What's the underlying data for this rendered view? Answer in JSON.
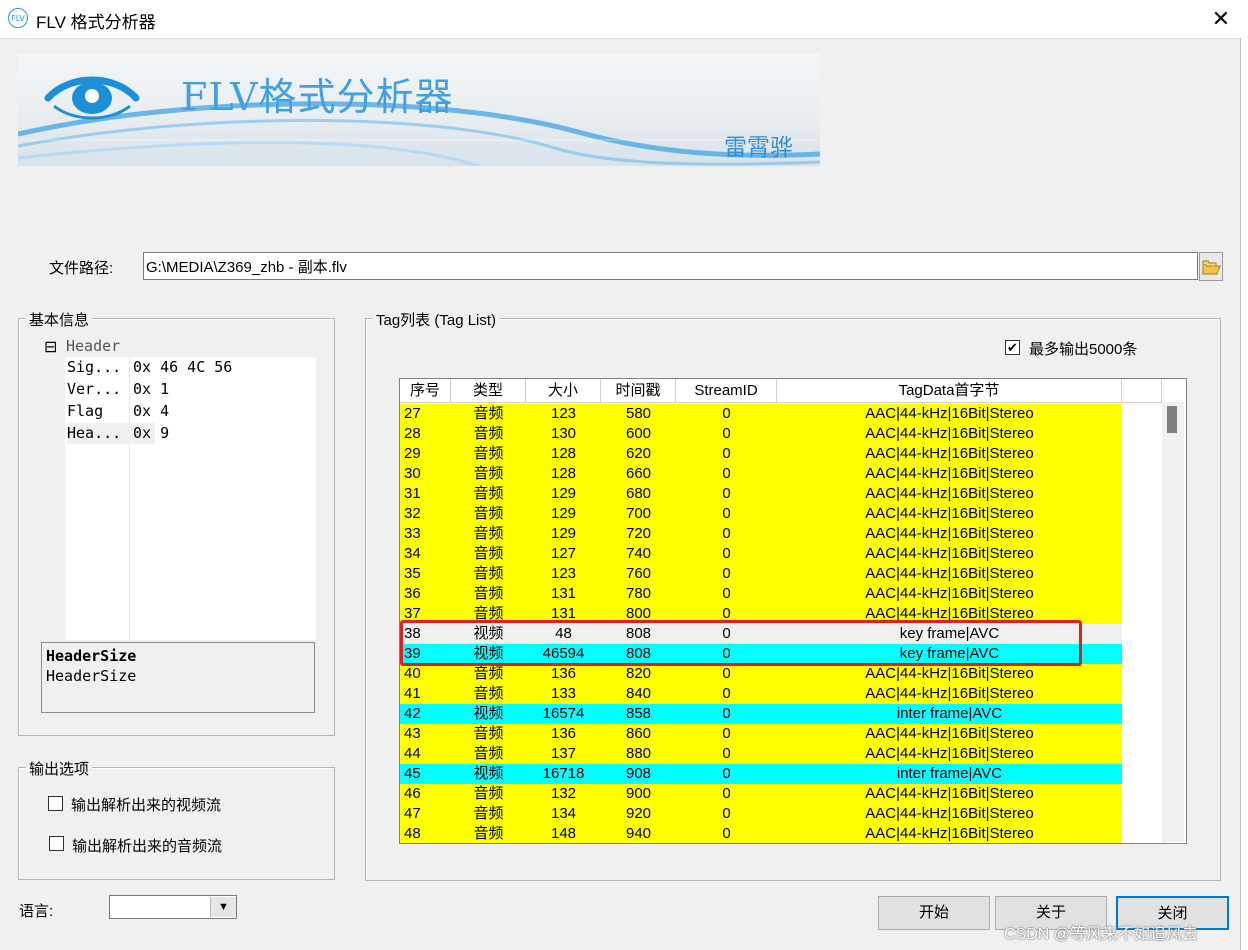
{
  "window": {
    "title": "FLV 格式分析器",
    "app_icon_text": "FLV",
    "close_glyph": "✕"
  },
  "banner": {
    "title": "FLV格式分析器",
    "author": "雷霄骅"
  },
  "file_path": {
    "label": "文件路径:",
    "value": "G:\\MEDIA\\Z369_zhb - 副本.flv"
  },
  "basic_info": {
    "legend": "基本信息",
    "tree_toggle": "⊟",
    "tree_root": "Header",
    "rows": [
      {
        "name": "Sig...",
        "value": "0x 46 4C 56"
      },
      {
        "name": "Ver...",
        "value": "0x 1"
      },
      {
        "name": "Flag",
        "value": "0x 4"
      },
      {
        "name": "Hea...",
        "value": "0x 9"
      }
    ],
    "description_title": "HeaderSize",
    "description_text": "HeaderSize"
  },
  "output_options": {
    "legend": "输出选项",
    "video_label": "输出解析出来的视频流",
    "audio_label": "输出解析出来的音频流",
    "video_checked": false,
    "audio_checked": false
  },
  "tag_list": {
    "legend": "Tag列表 (Tag List)",
    "max_output_label": "最多输出5000条",
    "max_output_checked": true,
    "columns": [
      "序号",
      "类型",
      "大小",
      "时间戳",
      "StreamID",
      "TagData首字节"
    ],
    "rows": [
      {
        "seq": "27",
        "type": "音频",
        "size": "123",
        "ts": "580",
        "sid": "0",
        "data": "AAC|44-kHz|16Bit|Stereo",
        "color": "#ffff00"
      },
      {
        "seq": "28",
        "type": "音频",
        "size": "130",
        "ts": "600",
        "sid": "0",
        "data": "AAC|44-kHz|16Bit|Stereo",
        "color": "#ffff00"
      },
      {
        "seq": "29",
        "type": "音频",
        "size": "128",
        "ts": "620",
        "sid": "0",
        "data": "AAC|44-kHz|16Bit|Stereo",
        "color": "#ffff00"
      },
      {
        "seq": "30",
        "type": "音频",
        "size": "128",
        "ts": "660",
        "sid": "0",
        "data": "AAC|44-kHz|16Bit|Stereo",
        "color": "#ffff00"
      },
      {
        "seq": "31",
        "type": "音频",
        "size": "129",
        "ts": "680",
        "sid": "0",
        "data": "AAC|44-kHz|16Bit|Stereo",
        "color": "#ffff00"
      },
      {
        "seq": "32",
        "type": "音频",
        "size": "129",
        "ts": "700",
        "sid": "0",
        "data": "AAC|44-kHz|16Bit|Stereo",
        "color": "#ffff00"
      },
      {
        "seq": "33",
        "type": "音频",
        "size": "129",
        "ts": "720",
        "sid": "0",
        "data": "AAC|44-kHz|16Bit|Stereo",
        "color": "#ffff00"
      },
      {
        "seq": "34",
        "type": "音频",
        "size": "127",
        "ts": "740",
        "sid": "0",
        "data": "AAC|44-kHz|16Bit|Stereo",
        "color": "#ffff00"
      },
      {
        "seq": "35",
        "type": "音频",
        "size": "123",
        "ts": "760",
        "sid": "0",
        "data": "AAC|44-kHz|16Bit|Stereo",
        "color": "#ffff00"
      },
      {
        "seq": "36",
        "type": "音频",
        "size": "131",
        "ts": "780",
        "sid": "0",
        "data": "AAC|44-kHz|16Bit|Stereo",
        "color": "#ffff00"
      },
      {
        "seq": "37",
        "type": "音频",
        "size": "131",
        "ts": "800",
        "sid": "0",
        "data": "AAC|44-kHz|16Bit|Stereo",
        "color": "#ffff00"
      },
      {
        "seq": "38",
        "type": "视频",
        "size": "48",
        "ts": "808",
        "sid": "0",
        "data": "key frame|AVC",
        "color": "#f0f0f0"
      },
      {
        "seq": "39",
        "type": "视频",
        "size": "46594",
        "ts": "808",
        "sid": "0",
        "data": "key frame|AVC",
        "color": "#00ffff"
      },
      {
        "seq": "40",
        "type": "音频",
        "size": "136",
        "ts": "820",
        "sid": "0",
        "data": "AAC|44-kHz|16Bit|Stereo",
        "color": "#ffff00"
      },
      {
        "seq": "41",
        "type": "音频",
        "size": "133",
        "ts": "840",
        "sid": "0",
        "data": "AAC|44-kHz|16Bit|Stereo",
        "color": "#ffff00"
      },
      {
        "seq": "42",
        "type": "视频",
        "size": "16574",
        "ts": "858",
        "sid": "0",
        "data": "inter frame|AVC",
        "color": "#00ffff"
      },
      {
        "seq": "43",
        "type": "音频",
        "size": "136",
        "ts": "860",
        "sid": "0",
        "data": "AAC|44-kHz|16Bit|Stereo",
        "color": "#ffff00"
      },
      {
        "seq": "44",
        "type": "音频",
        "size": "137",
        "ts": "880",
        "sid": "0",
        "data": "AAC|44-kHz|16Bit|Stereo",
        "color": "#ffff00"
      },
      {
        "seq": "45",
        "type": "视频",
        "size": "16718",
        "ts": "908",
        "sid": "0",
        "data": "inter frame|AVC",
        "color": "#00ffff"
      },
      {
        "seq": "46",
        "type": "音频",
        "size": "132",
        "ts": "900",
        "sid": "0",
        "data": "AAC|44-kHz|16Bit|Stereo",
        "color": "#ffff00"
      },
      {
        "seq": "47",
        "type": "音频",
        "size": "134",
        "ts": "920",
        "sid": "0",
        "data": "AAC|44-kHz|16Bit|Stereo",
        "color": "#ffff00"
      },
      {
        "seq": "48",
        "type": "音频",
        "size": "148",
        "ts": "940",
        "sid": "0",
        "data": "AAC|44-kHz|16Bit|Stereo",
        "color": "#ffff00"
      }
    ]
  },
  "language": {
    "label": "语言:",
    "selected": ""
  },
  "buttons": {
    "start": "开始",
    "about": "关于",
    "close": "关闭"
  },
  "watermark": "CSDN @等风来不如追风去",
  "icons": {
    "app": "flv-logo-icon",
    "eye": "eye-logo-icon",
    "folder": "open-folder-icon",
    "combo_arrow": "▼"
  }
}
